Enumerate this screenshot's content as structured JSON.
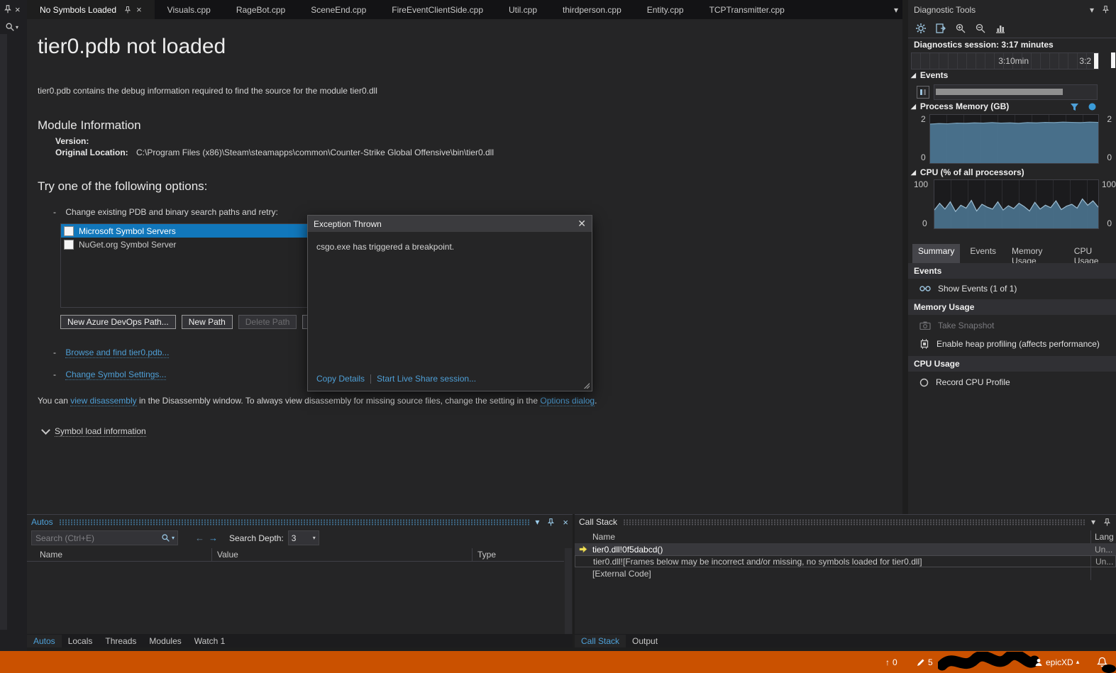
{
  "tabs": {
    "items": [
      "No Symbols Loaded",
      "Visuals.cpp",
      "RageBot.cpp",
      "SceneEnd.cpp",
      "FireEventClientSide.cpp",
      "Util.cpp",
      "thirdperson.cpp",
      "Entity.cpp",
      "TCPTransmitter.cpp"
    ]
  },
  "document": {
    "title": "tier0.pdb not loaded",
    "subtitle": "tier0.pdb contains the debug information required to find the source for the module tier0.dll",
    "module_info": {
      "heading": "Module Information",
      "version_label": "Version:",
      "location_label": "Original Location:",
      "location_value": "C:\\Program Files (x86)\\Steam\\steamapps\\common\\Counter-Strike Global Offensive\\bin\\tier0.dll"
    },
    "options_heading": "Try one of the following options:",
    "option_change_paths": "Change existing PDB and binary search paths and retry:",
    "symbol_servers": [
      {
        "label": "Microsoft Symbol Servers"
      },
      {
        "label": "NuGet.org Symbol Server"
      }
    ],
    "buttons": {
      "new_azure": "New Azure DevOps Path...",
      "new_path": "New Path",
      "delete_path": "Delete Path"
    },
    "link_browse": "Browse and find tier0.pdb...",
    "link_settings": "Change Symbol Settings...",
    "footer": {
      "pre": "You can ",
      "link_disassembly": "view disassembly",
      "mid": " in the Disassembly window. To always view disassembly for missing source files, change the setting in the ",
      "link_options": "Options dialog",
      "post": "."
    },
    "expander_label": "Symbol load information"
  },
  "dialog": {
    "title": "Exception Thrown",
    "message": "csgo.exe has triggered a breakpoint.",
    "link_copy_details": "Copy Details",
    "link_live_share": "Start Live Share session..."
  },
  "diagnostics": {
    "title": "Diagnostic Tools",
    "session_label": "Diagnostics session: 3:17 minutes",
    "ruler_tick": "3:10min",
    "ruler_tick_right": "3:2",
    "events_header": "Events",
    "memory_header": "Process Memory (GB)",
    "cpu_header": "CPU (% of all processors)",
    "memory_scale_top": "2",
    "memory_scale_bottom": "0",
    "cpu_scale_top": "100",
    "cpu_scale_bottom": "0",
    "tabs": [
      "Summary",
      "Events",
      "Memory Usage",
      "CPU Usage"
    ],
    "summary": {
      "events_section": "Events",
      "show_events": "Show Events (1 of 1)",
      "memory_section": "Memory Usage",
      "take_snapshot": "Take Snapshot",
      "heap_profiling": "Enable heap profiling (affects performance)",
      "cpu_section": "CPU Usage",
      "record_cpu": "Record CPU Profile"
    },
    "memory_series": [
      1.62,
      1.64,
      1.63,
      1.66,
      1.65,
      1.67,
      1.66,
      1.68,
      1.66,
      1.67,
      1.65,
      1.68,
      1.67,
      1.69,
      1.68,
      1.7,
      1.69,
      1.68,
      1.7,
      1.69
    ],
    "cpu_series": [
      38,
      52,
      40,
      55,
      35,
      48,
      42,
      58,
      36,
      50,
      44,
      40,
      55,
      38,
      47,
      41,
      52,
      45,
      36,
      54,
      40,
      48,
      43,
      57,
      39,
      46,
      50,
      42,
      61,
      48,
      57,
      44
    ]
  },
  "autos": {
    "title": "Autos",
    "search_placeholder": "Search (Ctrl+E)",
    "depth_label": "Search Depth:",
    "depth_value": "3",
    "columns": [
      "Name",
      "Value",
      "Type"
    ],
    "tabs": [
      "Autos",
      "Locals",
      "Threads",
      "Modules",
      "Watch 1"
    ]
  },
  "callstack": {
    "title": "Call Stack",
    "name_column": "Name",
    "lang_column": "Lang",
    "rows": [
      {
        "name": "tier0.dll!0f5dabcd()",
        "lang": "Un..."
      },
      {
        "name": "tier0.dll![Frames below may be incorrect and/or missing, no symbols loaded for tier0.dll]",
        "lang": "Un..."
      },
      {
        "name": "[External Code]",
        "lang": ""
      }
    ],
    "tabs": [
      "Call Stack",
      "Output"
    ]
  },
  "statusbar": {
    "up_count": "0",
    "edit_count": "5",
    "user": "epicXD"
  },
  "colors": {
    "accent": "#007acc",
    "selection": "#1177bb",
    "link": "#4e9fd6",
    "status_bg": "#ca5100",
    "chart_fill": "#4b7490"
  }
}
